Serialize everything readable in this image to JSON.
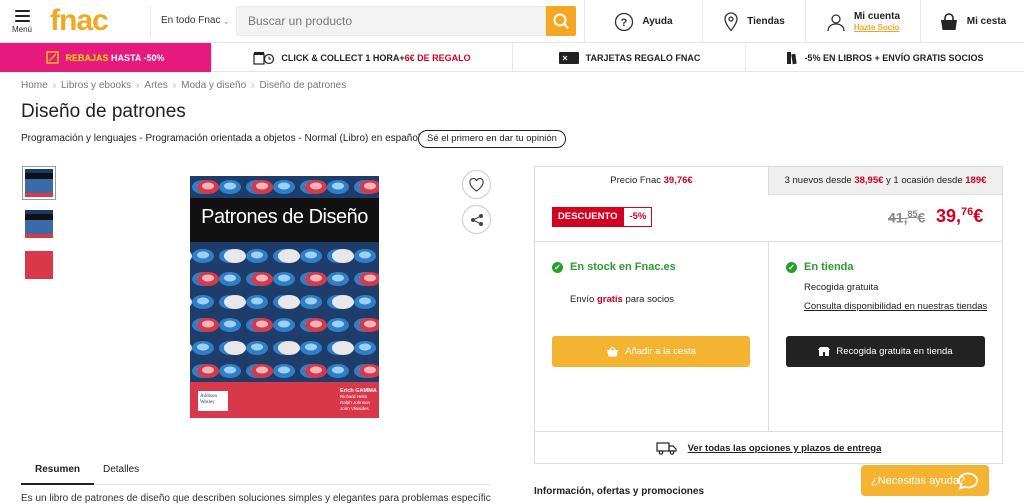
{
  "header": {
    "menu_label": "Menú",
    "logo": "fnac",
    "scope": "En todo Fnac",
    "search_placeholder": "Buscar un producto",
    "help": "Ayuda",
    "stores": "Tiendas",
    "account": "Mi cuenta",
    "account_sub": "Hazte Socio",
    "cart": "Mi cesta"
  },
  "promo": {
    "sale_a": "REBAJAS",
    "sale_b": "HASTA -50%",
    "click_a": "CLICK & COLLECT 1 HORA+ ",
    "click_b": "6€ DE REGALO",
    "gift": "TARJETAS REGALO FNAC",
    "books": "-5% EN LIBROS + ENVÍO GRATIS SOCIOS"
  },
  "breadcrumb": [
    "Home",
    "Libros y ebooks",
    "Artes",
    "Moda y diseño",
    "Diseño de patrones"
  ],
  "product": {
    "title": "Diseño de patrones",
    "meta": "Programación y lenguajes - Programación orientada a objetos - Normal (Libro) en español",
    "opinion_btn": "Sé el primero en dar tu opinión",
    "cover_title": "Patrones de Diseño",
    "cover_publisher": "Addison Wesley",
    "cover_authors_main": "Erich GAMMA",
    "cover_authors": [
      "Richard Helm",
      "Ralph Johnson",
      "John Vlissides"
    ]
  },
  "tabs": {
    "summary": "Resumen",
    "details": "Detalles"
  },
  "summary_text": "Es un libro de patrones de diseño que describen soluciones simples y elegantes para problemas específicos del",
  "price": {
    "fnac_label": "Precio Fnac ",
    "fnac_value": "39,76€",
    "market_a": "3 nuevos desde ",
    "market_b": "38,95€",
    "market_c": " y 1 ocasión desde ",
    "market_d": "189€",
    "discount_label": "DESCUENTO",
    "discount_pct": "-5%",
    "old_int": "41,",
    "old_dec": "85",
    "old_cur": "€",
    "new_int": "39,",
    "new_dec": "76",
    "new_cur": "€",
    "stock_online": "En stock en Fnac.es",
    "shipping_a": "Envío ",
    "shipping_b": "gratis",
    "shipping_c": " para socios",
    "stock_store": "En tienda",
    "pickup": "Recogida gratuita",
    "availability_link": "Consulta disponibilidad en nuestras tiendas",
    "add_to_cart": "Añadir a la cesta",
    "store_pickup": "Recogida gratuita en tienda",
    "delivery_link": "Ver todas las opciones y plazos de entrega"
  },
  "info_title": "Información, ofertas y promociones",
  "help_btn": "¿Necesitas ayuda?",
  "colors": {
    "brand": "#f5a623",
    "sale": "#e5197e",
    "price": "#d4001f",
    "stock": "#2b9d2b"
  }
}
